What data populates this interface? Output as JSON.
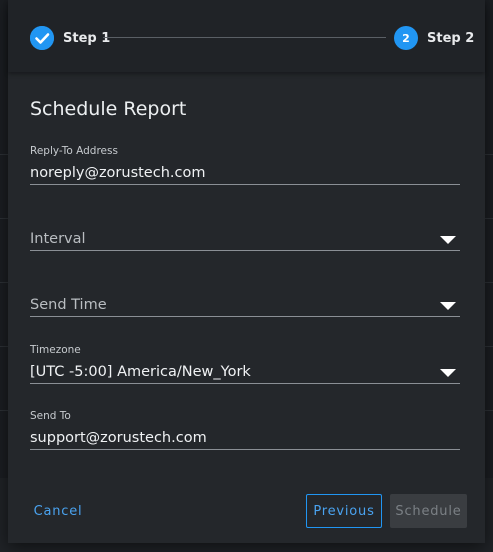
{
  "stepper": {
    "steps": [
      {
        "label": "Step 1",
        "state": "complete",
        "icon": "check-icon"
      },
      {
        "label": "Step 2",
        "number": "2",
        "state": "active"
      }
    ],
    "accent_color": "#2196f3"
  },
  "dialog": {
    "title": "Schedule Report"
  },
  "form": {
    "reply_to": {
      "label": "Reply-To Address",
      "value": "noreply@zorustech.com"
    },
    "interval": {
      "placeholder": "Interval",
      "icon": "chevron-down-icon"
    },
    "send_time": {
      "placeholder": "Send Time",
      "icon": "chevron-down-icon"
    },
    "timezone": {
      "label": "Timezone",
      "value": "[UTC -5:00] America/New_York",
      "icon": "chevron-down-icon"
    },
    "send_to": {
      "label": "Send To",
      "value": "support@zorustech.com"
    }
  },
  "actions": {
    "cancel_label": "Cancel",
    "previous_label": "Previous",
    "schedule_label": "Schedule"
  }
}
